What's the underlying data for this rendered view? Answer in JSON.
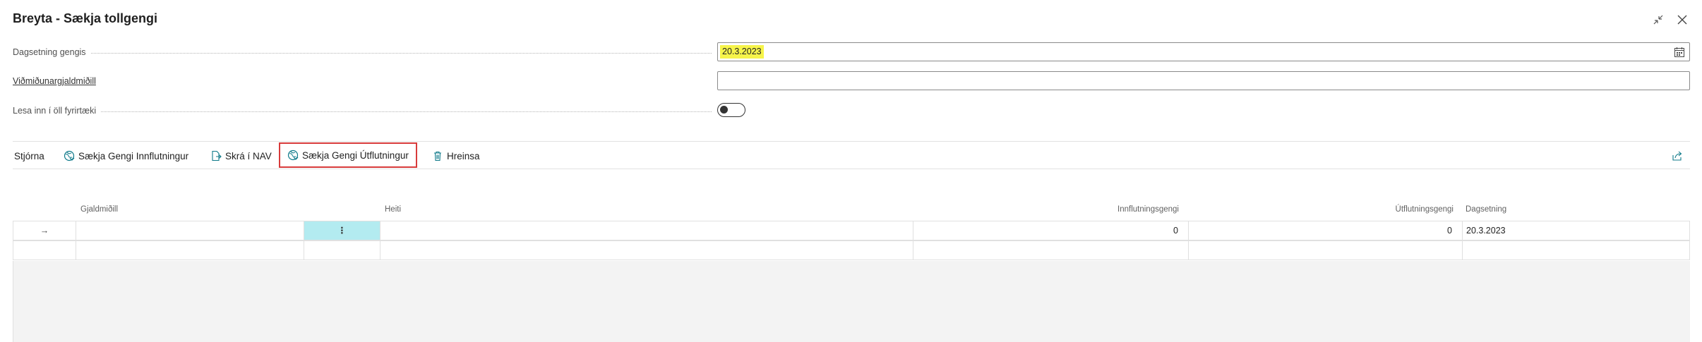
{
  "dialog": {
    "title": "Breyta - Sækja tollgengi"
  },
  "window_controls": {
    "collapse_icon": "collapse-icon",
    "close_icon": "close-icon"
  },
  "fields": {
    "date": {
      "label": "Dagsetning gengis",
      "value": "20.3.2023",
      "icon": "calendar-icon"
    },
    "ref_currency": {
      "label": "Viðmiðunargjaldmiðill",
      "value": ""
    },
    "all_companies": {
      "label": "Lesa inn í öll fyrirtæki",
      "checked": false
    }
  },
  "actions": {
    "manage": "Stjórna",
    "fetch_import": "Sækja Gengi Innflutningur",
    "register_nav": "Skrá í NAV",
    "fetch_export": "Sækja Gengi Útflutningur",
    "clear": "Hreinsa",
    "share_icon": "share-icon"
  },
  "grid": {
    "headers": {
      "currency": "Gjaldmiðill",
      "name": "Heiti",
      "import_rate": "Innflutningsgengi",
      "export_rate": "Útflutningsgengi",
      "date": "Dagsetning"
    },
    "rows": [
      {
        "indicator": "→",
        "currency": "",
        "menu": "⋮",
        "name": "",
        "import_rate": "0",
        "export_rate": "0",
        "date": "20.3.2023"
      },
      {
        "indicator": "",
        "currency": "",
        "menu": "",
        "name": "",
        "import_rate": "",
        "export_rate": "",
        "date": ""
      }
    ]
  },
  "colors": {
    "accent": "#0f7a8a",
    "highlight_field": "#f6f44a",
    "selected_cell": "#b3ebf0",
    "focus_border": "#d83b3b"
  }
}
